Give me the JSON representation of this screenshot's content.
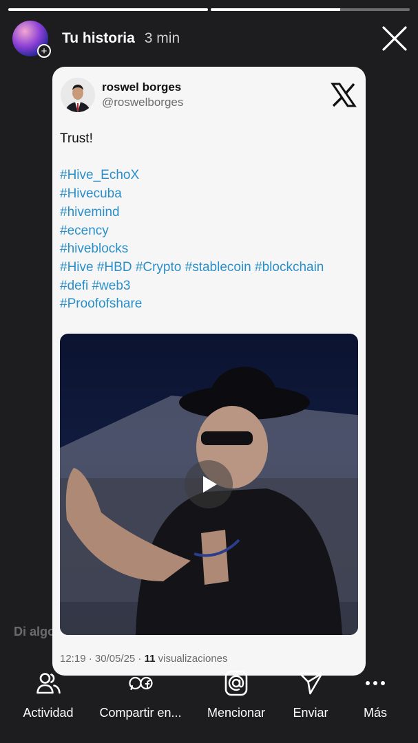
{
  "story": {
    "user": "Tu historia",
    "time": "3 min",
    "progress": [
      1.0,
      0.65
    ]
  },
  "tweet": {
    "name": "roswel borges",
    "handle": "@roswelborges",
    "text": "Trust!",
    "hashtag_lines": [
      "#Hive_EchoX",
      "#Hivecuba",
      "#hivemind",
      "#ecency",
      "#hiveblocks",
      "#Hive #HBD #Crypto #stablecoin #blockchain",
      "#defi #web3",
      "#Proofofshare"
    ],
    "meta_prefix": "12:19 · 30/05/25 · ",
    "views_count": "11",
    "views_label": " visualizaciones"
  },
  "reply_placeholder": "Di algo...",
  "actions": [
    {
      "label": "Actividad",
      "icon": "people-icon"
    },
    {
      "label": "Compartir en...",
      "icon": "share-apps-icon"
    },
    {
      "label": "Mencionar",
      "icon": "mention-icon"
    },
    {
      "label": "Enviar",
      "icon": "send-icon"
    },
    {
      "label": "Más",
      "icon": "more-icon"
    }
  ],
  "colors": {
    "background": "#1d1d1f",
    "hashtag": "#2a8fc9",
    "card": "#f6f6f7"
  }
}
